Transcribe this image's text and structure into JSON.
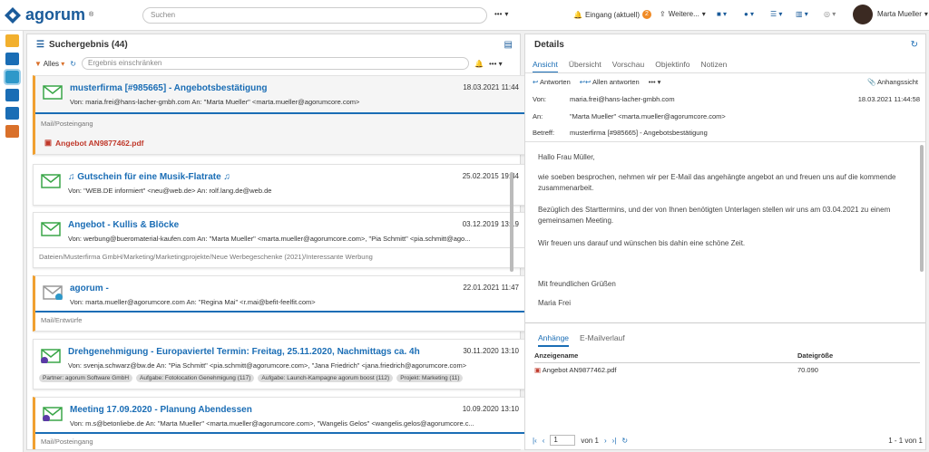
{
  "app": {
    "name": "agorum"
  },
  "header": {
    "search_placeholder": "Suchen",
    "more": "•••",
    "inbox_label": "Eingang (aktuell)",
    "inbox_count": "2",
    "weitere": "Weitere...",
    "user_name": "Marta Mueller"
  },
  "results": {
    "title": "Suchergebnis (44)",
    "filter_label": "Alles",
    "filter_placeholder": "Ergebnis einschränken",
    "items": [
      {
        "title": "musterfirma [#985665] - Angebotsbestätigung",
        "date": "18.03.2021 11:44",
        "meta": "Von: maria.frei@hans-lacher-gmbh.com   An: \"Marta Mueller\" <marta.mueller@agorumcore.com>",
        "path": "Mail/Posteingang",
        "attachment": "Angebot AN9877462.pdf"
      },
      {
        "title": "♫ Gutschein für eine Musik-Flatrate ♫",
        "date": "25.02.2015 19:44",
        "meta": "Von: \"WEB.DE informiert\" <neu@web.de>   An: rolf.lang.de@web.de"
      },
      {
        "title": "Angebot - Kullis & Blöcke",
        "date": "03.12.2019 13:19",
        "meta": "Von: werbung@bueromaterial-kaufen.com   An: \"Marta Mueller\" <marta.mueller@agorumcore.com>, \"Pia Schmitt\" <pia.schmitt@ago...",
        "path": "Dateien/Musterfirma GmbH/Marketing/Marketingprojekte/Neue Werbegeschenke (2021)/Interessante Werbung"
      },
      {
        "title": "agorum -",
        "date": "22.01.2021 11:47",
        "meta": "Von: marta.mueller@agorumcore.com   An: \"Regina Mai\" <r.mai@befit-feelfit.com>",
        "path": "Mail/Entwürfe"
      },
      {
        "title": "Drehgenehmigung - Europaviertel Termin: Freitag, 25.11.2020, Nachmittags ca. 4h",
        "date": "30.11.2020 13:10",
        "meta": "Von: svenja.schwarz@bw.de   An: \"Pia Schmitt\" <pia.schmitt@agorumcore.com>, \"Jana Friedrich\" <jana.friedrich@agorumcore.com>",
        "tags": [
          "Partner: agorum Software GmbH",
          "Aufgabe: Fotolocation Genehmigung (117)",
          "Aufgabe: Launch-Kampagne agorum boost (112)",
          "Projekt: Marketing (11)"
        ]
      },
      {
        "title": "Meeting 17.09.2020 - Planung Abendessen",
        "date": "10.09.2020 13:10",
        "meta": "Von: m.s@betonliebe.de   An: \"Marta Mueller\" <marta.mueller@agorumcore.com>, \"Wangelis Gelos\" <wangelis.gelos@agorumcore.c...",
        "path": "Mail/Posteingang"
      }
    ]
  },
  "details": {
    "title": "Details",
    "tabs": [
      "Ansicht",
      "Übersicht",
      "Vorschau",
      "Objektinfo",
      "Notizen"
    ],
    "reply": "Antworten",
    "reply_all": "Allen antworten",
    "attachment_view": "Anhangssicht",
    "from_label": "Von:",
    "from": "maria.frei@hans-lacher-gmbh.com",
    "date": "18.03.2021 11:44:58",
    "to_label": "An:",
    "to": "\"Marta Mueller\" <marta.mueller@agorumcore.com>",
    "subject_label": "Betreff:",
    "subject": "musterfirma [#985665] - Angebotsbestätigung",
    "body": [
      "Hallo Frau Müller,",
      "wie soeben besprochen, nehmen wir per E-Mail das angehängte angebot an und freuen uns auf die kommende zusammenarbeit.",
      "Bezüglich des Starttermins, und der von Ihnen benötigten Unterlagen stellen wir uns am 03.04.2021 zu einem gemeinsamen Meeting.",
      "Wir freuen uns darauf und wünschen bis dahin eine schöne Zeit.",
      "Mit freundlichen Grüßen",
      "Maria Frei"
    ],
    "att_tabs": [
      "Anhänge",
      "E-Mailverlauf"
    ],
    "att_col_name": "Anzeigename",
    "att_col_size": "Dateigröße",
    "att_name": "Angebot AN9877462.pdf",
    "att_size": "70.090",
    "page": "1",
    "of": "von 1",
    "range": "1 - 1 von 1"
  },
  "colors": {
    "accent": "#1a6db5",
    "orange": "#f0a030",
    "green": "#3aa648"
  }
}
